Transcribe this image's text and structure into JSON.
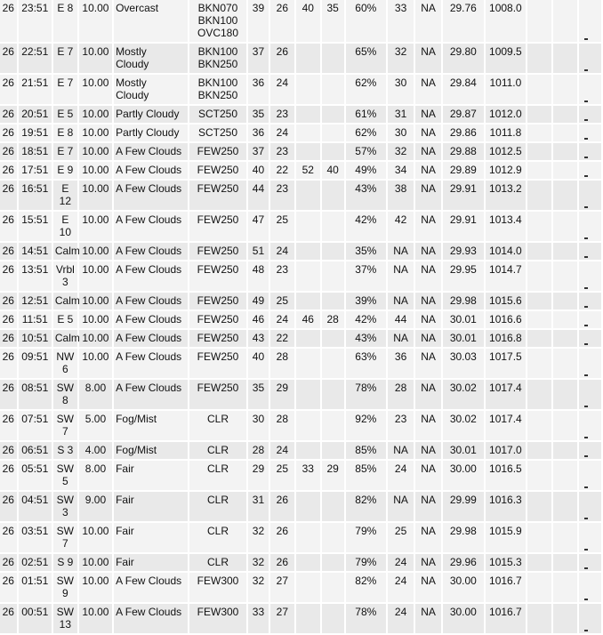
{
  "table": {
    "rows": [
      {
        "date": "26",
        "time": "23:51",
        "wind": "E 8",
        "vis": "10.00",
        "weather": "Overcast",
        "sky": [
          "BKN070",
          "BKN100",
          "OVC180"
        ],
        "temp": "39",
        "dew": "26",
        "max6": "40",
        "min6": "35",
        "rh": "60%",
        "windchill": "33",
        "heatindex": "NA",
        "altimeter": "29.76",
        "slp": "1008.0"
      },
      {
        "date": "26",
        "time": "22:51",
        "wind": "E 7",
        "vis": "10.00",
        "weather": "Mostly Cloudy",
        "sky": [
          "BKN100",
          "BKN250"
        ],
        "temp": "37",
        "dew": "26",
        "max6": "",
        "min6": "",
        "rh": "65%",
        "windchill": "32",
        "heatindex": "NA",
        "altimeter": "29.80",
        "slp": "1009.5"
      },
      {
        "date": "26",
        "time": "21:51",
        "wind": "E 7",
        "vis": "10.00",
        "weather": "Mostly Cloudy",
        "sky": [
          "BKN100",
          "BKN250"
        ],
        "temp": "36",
        "dew": "24",
        "max6": "",
        "min6": "",
        "rh": "62%",
        "windchill": "30",
        "heatindex": "NA",
        "altimeter": "29.84",
        "slp": "1011.0"
      },
      {
        "date": "26",
        "time": "20:51",
        "wind": "E 5",
        "vis": "10.00",
        "weather": "Partly Cloudy",
        "sky": [
          "SCT250"
        ],
        "temp": "35",
        "dew": "23",
        "max6": "",
        "min6": "",
        "rh": "61%",
        "windchill": "31",
        "heatindex": "NA",
        "altimeter": "29.87",
        "slp": "1012.0"
      },
      {
        "date": "26",
        "time": "19:51",
        "wind": "E 8",
        "vis": "10.00",
        "weather": "Partly Cloudy",
        "sky": [
          "SCT250"
        ],
        "temp": "36",
        "dew": "24",
        "max6": "",
        "min6": "",
        "rh": "62%",
        "windchill": "30",
        "heatindex": "NA",
        "altimeter": "29.86",
        "slp": "1011.8"
      },
      {
        "date": "26",
        "time": "18:51",
        "wind": "E 7",
        "vis": "10.00",
        "weather": "A Few Clouds",
        "sky": [
          "FEW250"
        ],
        "temp": "37",
        "dew": "23",
        "max6": "",
        "min6": "",
        "rh": "57%",
        "windchill": "32",
        "heatindex": "NA",
        "altimeter": "29.88",
        "slp": "1012.5"
      },
      {
        "date": "26",
        "time": "17:51",
        "wind": "E 9",
        "vis": "10.00",
        "weather": "A Few Clouds",
        "sky": [
          "FEW250"
        ],
        "temp": "40",
        "dew": "22",
        "max6": "52",
        "min6": "40",
        "rh": "49%",
        "windchill": "34",
        "heatindex": "NA",
        "altimeter": "29.89",
        "slp": "1012.9"
      },
      {
        "date": "26",
        "time": "16:51",
        "wind": "E 12",
        "vis": "10.00",
        "weather": "A Few Clouds",
        "sky": [
          "FEW250"
        ],
        "temp": "44",
        "dew": "23",
        "max6": "",
        "min6": "",
        "rh": "43%",
        "windchill": "38",
        "heatindex": "NA",
        "altimeter": "29.91",
        "slp": "1013.2"
      },
      {
        "date": "26",
        "time": "15:51",
        "wind": "E 10",
        "vis": "10.00",
        "weather": "A Few Clouds",
        "sky": [
          "FEW250"
        ],
        "temp": "47",
        "dew": "25",
        "max6": "",
        "min6": "",
        "rh": "42%",
        "windchill": "42",
        "heatindex": "NA",
        "altimeter": "29.91",
        "slp": "1013.4"
      },
      {
        "date": "26",
        "time": "14:51",
        "wind": "Calm",
        "vis": "10.00",
        "weather": "A Few Clouds",
        "sky": [
          "FEW250"
        ],
        "temp": "51",
        "dew": "24",
        "max6": "",
        "min6": "",
        "rh": "35%",
        "windchill": "NA",
        "heatindex": "NA",
        "altimeter": "29.93",
        "slp": "1014.0"
      },
      {
        "date": "26",
        "time": "13:51",
        "wind": "Vrbl 3",
        "vis": "10.00",
        "weather": "A Few Clouds",
        "sky": [
          "FEW250"
        ],
        "temp": "48",
        "dew": "23",
        "max6": "",
        "min6": "",
        "rh": "37%",
        "windchill": "NA",
        "heatindex": "NA",
        "altimeter": "29.95",
        "slp": "1014.7"
      },
      {
        "date": "26",
        "time": "12:51",
        "wind": "Calm",
        "vis": "10.00",
        "weather": "A Few Clouds",
        "sky": [
          "FEW250"
        ],
        "temp": "49",
        "dew": "25",
        "max6": "",
        "min6": "",
        "rh": "39%",
        "windchill": "NA",
        "heatindex": "NA",
        "altimeter": "29.98",
        "slp": "1015.6"
      },
      {
        "date": "26",
        "time": "11:51",
        "wind": "E 5",
        "vis": "10.00",
        "weather": "A Few Clouds",
        "sky": [
          "FEW250"
        ],
        "temp": "46",
        "dew": "24",
        "max6": "46",
        "min6": "28",
        "rh": "42%",
        "windchill": "44",
        "heatindex": "NA",
        "altimeter": "30.01",
        "slp": "1016.6"
      },
      {
        "date": "26",
        "time": "10:51",
        "wind": "Calm",
        "vis": "10.00",
        "weather": "A Few Clouds",
        "sky": [
          "FEW250"
        ],
        "temp": "43",
        "dew": "22",
        "max6": "",
        "min6": "",
        "rh": "43%",
        "windchill": "NA",
        "heatindex": "NA",
        "altimeter": "30.01",
        "slp": "1016.8"
      },
      {
        "date": "26",
        "time": "09:51",
        "wind": "NW 6",
        "vis": "10.00",
        "weather": "A Few Clouds",
        "sky": [
          "FEW250"
        ],
        "temp": "40",
        "dew": "28",
        "max6": "",
        "min6": "",
        "rh": "63%",
        "windchill": "36",
        "heatindex": "NA",
        "altimeter": "30.03",
        "slp": "1017.5"
      },
      {
        "date": "26",
        "time": "08:51",
        "wind": "SW 8",
        "vis": "8.00",
        "weather": "A Few Clouds",
        "sky": [
          "FEW250"
        ],
        "temp": "35",
        "dew": "29",
        "max6": "",
        "min6": "",
        "rh": "78%",
        "windchill": "28",
        "heatindex": "NA",
        "altimeter": "30.02",
        "slp": "1017.4"
      },
      {
        "date": "26",
        "time": "07:51",
        "wind": "SW 7",
        "vis": "5.00",
        "weather": "Fog/Mist",
        "sky": [
          "CLR"
        ],
        "temp": "30",
        "dew": "28",
        "max6": "",
        "min6": "",
        "rh": "92%",
        "windchill": "23",
        "heatindex": "NA",
        "altimeter": "30.02",
        "slp": "1017.4"
      },
      {
        "date": "26",
        "time": "06:51",
        "wind": "S 3",
        "vis": "4.00",
        "weather": "Fog/Mist",
        "sky": [
          "CLR"
        ],
        "temp": "28",
        "dew": "24",
        "max6": "",
        "min6": "",
        "rh": "85%",
        "windchill": "NA",
        "heatindex": "NA",
        "altimeter": "30.01",
        "slp": "1017.0"
      },
      {
        "date": "26",
        "time": "05:51",
        "wind": "SW 5",
        "vis": "8.00",
        "weather": "Fair",
        "sky": [
          "CLR"
        ],
        "temp": "29",
        "dew": "25",
        "max6": "33",
        "min6": "29",
        "rh": "85%",
        "windchill": "24",
        "heatindex": "NA",
        "altimeter": "30.00",
        "slp": "1016.5"
      },
      {
        "date": "26",
        "time": "04:51",
        "wind": "SW 3",
        "vis": "9.00",
        "weather": "Fair",
        "sky": [
          "CLR"
        ],
        "temp": "31",
        "dew": "26",
        "max6": "",
        "min6": "",
        "rh": "82%",
        "windchill": "NA",
        "heatindex": "NA",
        "altimeter": "29.99",
        "slp": "1016.3"
      },
      {
        "date": "26",
        "time": "03:51",
        "wind": "SW 7",
        "vis": "10.00",
        "weather": "Fair",
        "sky": [
          "CLR"
        ],
        "temp": "32",
        "dew": "26",
        "max6": "",
        "min6": "",
        "rh": "79%",
        "windchill": "25",
        "heatindex": "NA",
        "altimeter": "29.98",
        "slp": "1015.9"
      },
      {
        "date": "26",
        "time": "02:51",
        "wind": "S 9",
        "vis": "10.00",
        "weather": "Fair",
        "sky": [
          "CLR"
        ],
        "temp": "32",
        "dew": "26",
        "max6": "",
        "min6": "",
        "rh": "79%",
        "windchill": "24",
        "heatindex": "NA",
        "altimeter": "29.96",
        "slp": "1015.3"
      },
      {
        "date": "26",
        "time": "01:51",
        "wind": "SW 9",
        "vis": "10.00",
        "weather": "A Few Clouds",
        "sky": [
          "FEW300"
        ],
        "temp": "32",
        "dew": "27",
        "max6": "",
        "min6": "",
        "rh": "82%",
        "windchill": "24",
        "heatindex": "NA",
        "altimeter": "30.00",
        "slp": "1016.7"
      },
      {
        "date": "26",
        "time": "00:51",
        "wind": "SW 13",
        "vis": "10.00",
        "weather": "A Few Clouds",
        "sky": [
          "FEW300"
        ],
        "temp": "33",
        "dew": "27",
        "max6": "",
        "min6": "",
        "rh": "78%",
        "windchill": "24",
        "heatindex": "NA",
        "altimeter": "30.00",
        "slp": "1016.7"
      }
    ]
  }
}
